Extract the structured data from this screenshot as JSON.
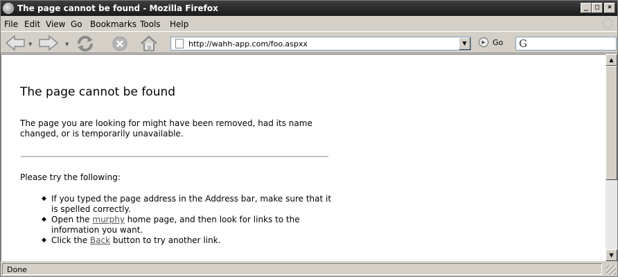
{
  "window": {
    "title": "The page cannot be found - Mozilla Firefox",
    "minimize_label": "_",
    "maximize_label": "□",
    "close_label": "×"
  },
  "menu": {
    "items": [
      {
        "label": "File"
      },
      {
        "label": "Edit"
      },
      {
        "label": "View"
      },
      {
        "label": "Go"
      },
      {
        "label": "Bookmarks"
      },
      {
        "label": "Tools"
      },
      {
        "label": "Help"
      }
    ]
  },
  "toolbar": {
    "url": "http://wahh-app.com/foo.aspxx",
    "go_label": "Go",
    "search_logo": "G"
  },
  "page": {
    "heading": "The page cannot be found",
    "message": "The page you are looking for might have been removed, had its name changed, or is temporarily unavailable.",
    "try_label": "Please try the following:",
    "item1": "If you typed the page address in the Address bar, make sure that it is spelled correctly.",
    "item2_pre": "Open the ",
    "item2_link": "murphy",
    "item2_post": " home page, and then look for links to the information you want.",
    "item3_pre": "Click the ",
    "item3_link": "Back",
    "item3_post": " button to try another link."
  },
  "status": {
    "text": "Done"
  },
  "colors": {
    "titlebar": "#2a2a2a",
    "chrome": "#d4d0c8",
    "link": "#555555"
  }
}
